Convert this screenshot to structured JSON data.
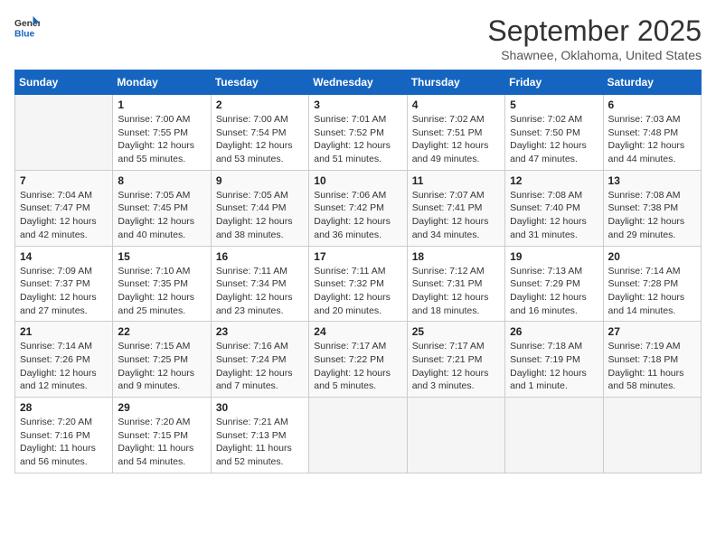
{
  "logo": {
    "line1": "General",
    "line2": "Blue"
  },
  "title": "September 2025",
  "subtitle": "Shawnee, Oklahoma, United States",
  "days_of_week": [
    "Sunday",
    "Monday",
    "Tuesday",
    "Wednesday",
    "Thursday",
    "Friday",
    "Saturday"
  ],
  "weeks": [
    [
      {
        "day": "",
        "info": ""
      },
      {
        "day": "1",
        "info": "Sunrise: 7:00 AM\nSunset: 7:55 PM\nDaylight: 12 hours\nand 55 minutes."
      },
      {
        "day": "2",
        "info": "Sunrise: 7:00 AM\nSunset: 7:54 PM\nDaylight: 12 hours\nand 53 minutes."
      },
      {
        "day": "3",
        "info": "Sunrise: 7:01 AM\nSunset: 7:52 PM\nDaylight: 12 hours\nand 51 minutes."
      },
      {
        "day": "4",
        "info": "Sunrise: 7:02 AM\nSunset: 7:51 PM\nDaylight: 12 hours\nand 49 minutes."
      },
      {
        "day": "5",
        "info": "Sunrise: 7:02 AM\nSunset: 7:50 PM\nDaylight: 12 hours\nand 47 minutes."
      },
      {
        "day": "6",
        "info": "Sunrise: 7:03 AM\nSunset: 7:48 PM\nDaylight: 12 hours\nand 44 minutes."
      }
    ],
    [
      {
        "day": "7",
        "info": "Sunrise: 7:04 AM\nSunset: 7:47 PM\nDaylight: 12 hours\nand 42 minutes."
      },
      {
        "day": "8",
        "info": "Sunrise: 7:05 AM\nSunset: 7:45 PM\nDaylight: 12 hours\nand 40 minutes."
      },
      {
        "day": "9",
        "info": "Sunrise: 7:05 AM\nSunset: 7:44 PM\nDaylight: 12 hours\nand 38 minutes."
      },
      {
        "day": "10",
        "info": "Sunrise: 7:06 AM\nSunset: 7:42 PM\nDaylight: 12 hours\nand 36 minutes."
      },
      {
        "day": "11",
        "info": "Sunrise: 7:07 AM\nSunset: 7:41 PM\nDaylight: 12 hours\nand 34 minutes."
      },
      {
        "day": "12",
        "info": "Sunrise: 7:08 AM\nSunset: 7:40 PM\nDaylight: 12 hours\nand 31 minutes."
      },
      {
        "day": "13",
        "info": "Sunrise: 7:08 AM\nSunset: 7:38 PM\nDaylight: 12 hours\nand 29 minutes."
      }
    ],
    [
      {
        "day": "14",
        "info": "Sunrise: 7:09 AM\nSunset: 7:37 PM\nDaylight: 12 hours\nand 27 minutes."
      },
      {
        "day": "15",
        "info": "Sunrise: 7:10 AM\nSunset: 7:35 PM\nDaylight: 12 hours\nand 25 minutes."
      },
      {
        "day": "16",
        "info": "Sunrise: 7:11 AM\nSunset: 7:34 PM\nDaylight: 12 hours\nand 23 minutes."
      },
      {
        "day": "17",
        "info": "Sunrise: 7:11 AM\nSunset: 7:32 PM\nDaylight: 12 hours\nand 20 minutes."
      },
      {
        "day": "18",
        "info": "Sunrise: 7:12 AM\nSunset: 7:31 PM\nDaylight: 12 hours\nand 18 minutes."
      },
      {
        "day": "19",
        "info": "Sunrise: 7:13 AM\nSunset: 7:29 PM\nDaylight: 12 hours\nand 16 minutes."
      },
      {
        "day": "20",
        "info": "Sunrise: 7:14 AM\nSunset: 7:28 PM\nDaylight: 12 hours\nand 14 minutes."
      }
    ],
    [
      {
        "day": "21",
        "info": "Sunrise: 7:14 AM\nSunset: 7:26 PM\nDaylight: 12 hours\nand 12 minutes."
      },
      {
        "day": "22",
        "info": "Sunrise: 7:15 AM\nSunset: 7:25 PM\nDaylight: 12 hours\nand 9 minutes."
      },
      {
        "day": "23",
        "info": "Sunrise: 7:16 AM\nSunset: 7:24 PM\nDaylight: 12 hours\nand 7 minutes."
      },
      {
        "day": "24",
        "info": "Sunrise: 7:17 AM\nSunset: 7:22 PM\nDaylight: 12 hours\nand 5 minutes."
      },
      {
        "day": "25",
        "info": "Sunrise: 7:17 AM\nSunset: 7:21 PM\nDaylight: 12 hours\nand 3 minutes."
      },
      {
        "day": "26",
        "info": "Sunrise: 7:18 AM\nSunset: 7:19 PM\nDaylight: 12 hours\nand 1 minute."
      },
      {
        "day": "27",
        "info": "Sunrise: 7:19 AM\nSunset: 7:18 PM\nDaylight: 11 hours\nand 58 minutes."
      }
    ],
    [
      {
        "day": "28",
        "info": "Sunrise: 7:20 AM\nSunset: 7:16 PM\nDaylight: 11 hours\nand 56 minutes."
      },
      {
        "day": "29",
        "info": "Sunrise: 7:20 AM\nSunset: 7:15 PM\nDaylight: 11 hours\nand 54 minutes."
      },
      {
        "day": "30",
        "info": "Sunrise: 7:21 AM\nSunset: 7:13 PM\nDaylight: 11 hours\nand 52 minutes."
      },
      {
        "day": "",
        "info": ""
      },
      {
        "day": "",
        "info": ""
      },
      {
        "day": "",
        "info": ""
      },
      {
        "day": "",
        "info": ""
      }
    ]
  ]
}
